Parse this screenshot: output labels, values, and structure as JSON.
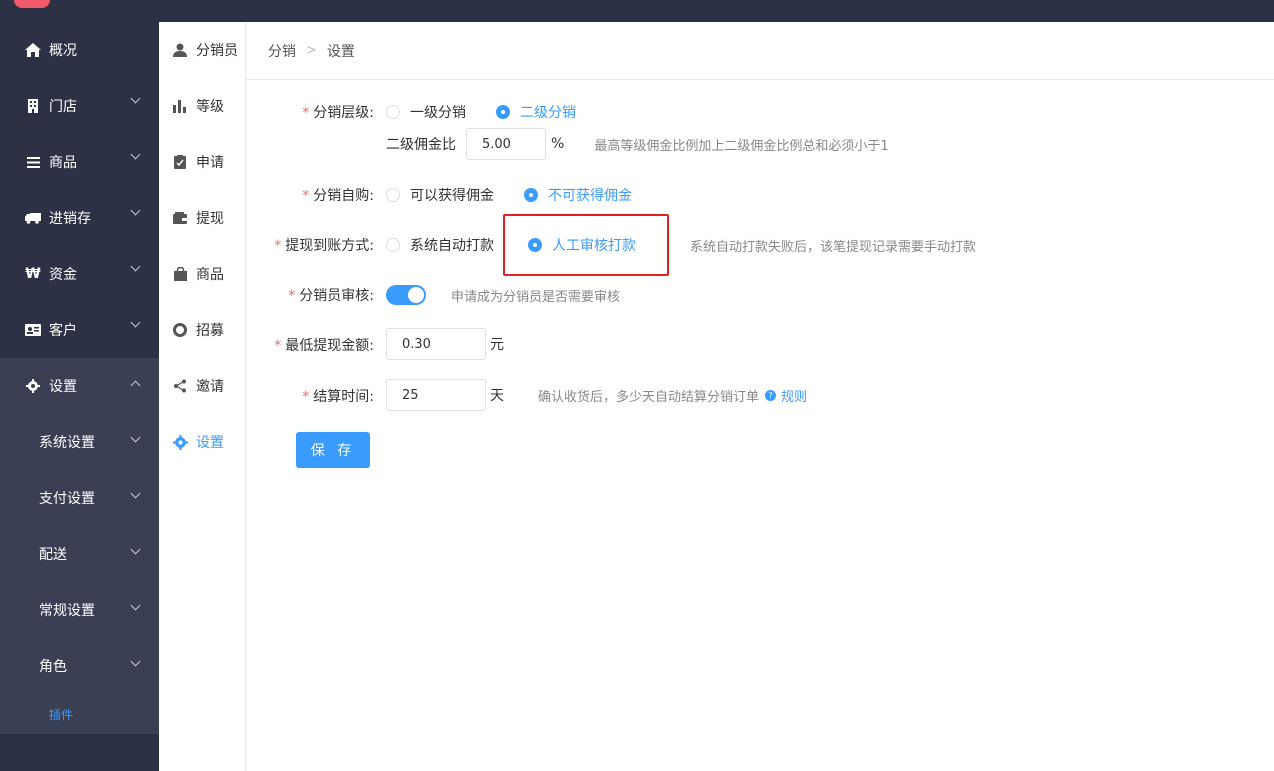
{
  "sidebar": {
    "items": [
      {
        "label": "概况",
        "icon": "home-icon"
      },
      {
        "label": "门店",
        "icon": "building-icon"
      },
      {
        "label": "商品",
        "icon": "list-icon"
      },
      {
        "label": "进销存",
        "icon": "truck-icon"
      },
      {
        "label": "资金",
        "icon": "won-icon"
      },
      {
        "label": "客户",
        "icon": "id-card-icon"
      },
      {
        "label": "设置",
        "icon": "gear-icon"
      }
    ],
    "sub_items": [
      {
        "label": "系统设置"
      },
      {
        "label": "支付设置"
      },
      {
        "label": "配送"
      },
      {
        "label": "常规设置"
      },
      {
        "label": "角色"
      }
    ],
    "leaf": "插件"
  },
  "subnav": {
    "items": [
      {
        "label": "分销员",
        "icon": "user-icon"
      },
      {
        "label": "等级",
        "icon": "bar-chart-icon"
      },
      {
        "label": "申请",
        "icon": "clipboard-icon"
      },
      {
        "label": "提现",
        "icon": "wallet-icon"
      },
      {
        "label": "商品",
        "icon": "bag-icon"
      },
      {
        "label": "招募",
        "icon": "lifebuoy-icon"
      },
      {
        "label": "邀请",
        "icon": "share-icon"
      },
      {
        "label": "设置",
        "icon": "gear-icon"
      }
    ]
  },
  "breadcrumb": {
    "parent": "分销",
    "current": "设置"
  },
  "form": {
    "level": {
      "label": "分销层级:",
      "options": [
        "一级分销",
        "二级分销"
      ],
      "selected": "二级分销"
    },
    "commission": {
      "label": "二级佣金比",
      "value": "5.00",
      "unit": "%",
      "hint": "最高等级佣金比例加上二级佣金比例总和必须小于1"
    },
    "self_buy": {
      "label": "分销自购:",
      "options": [
        "可以获得佣金",
        "不可获得佣金"
      ],
      "selected": "不可获得佣金"
    },
    "withdraw": {
      "label": "提现到账方式:",
      "options": [
        "系统自动打款",
        "人工审核打款"
      ],
      "selected": "人工审核打款",
      "hint": "系统自动打款失败后，该笔提现记录需要手动打款"
    },
    "audit": {
      "label": "分销员审核:",
      "enabled": true,
      "hint": "申请成为分销员是否需要审核"
    },
    "min_withdraw": {
      "label": "最低提现金额:",
      "value": "0.30",
      "unit": "元"
    },
    "settle": {
      "label": "结算时间:",
      "value": "25",
      "unit": "天",
      "hint": "确认收货后，多少天自动结算分销订单",
      "rule_link": "规则"
    },
    "save_label": "保 存"
  },
  "colors": {
    "accent": "#3a9bff",
    "sidebar_bg": "#2c3146",
    "highlight": "#e62020"
  }
}
